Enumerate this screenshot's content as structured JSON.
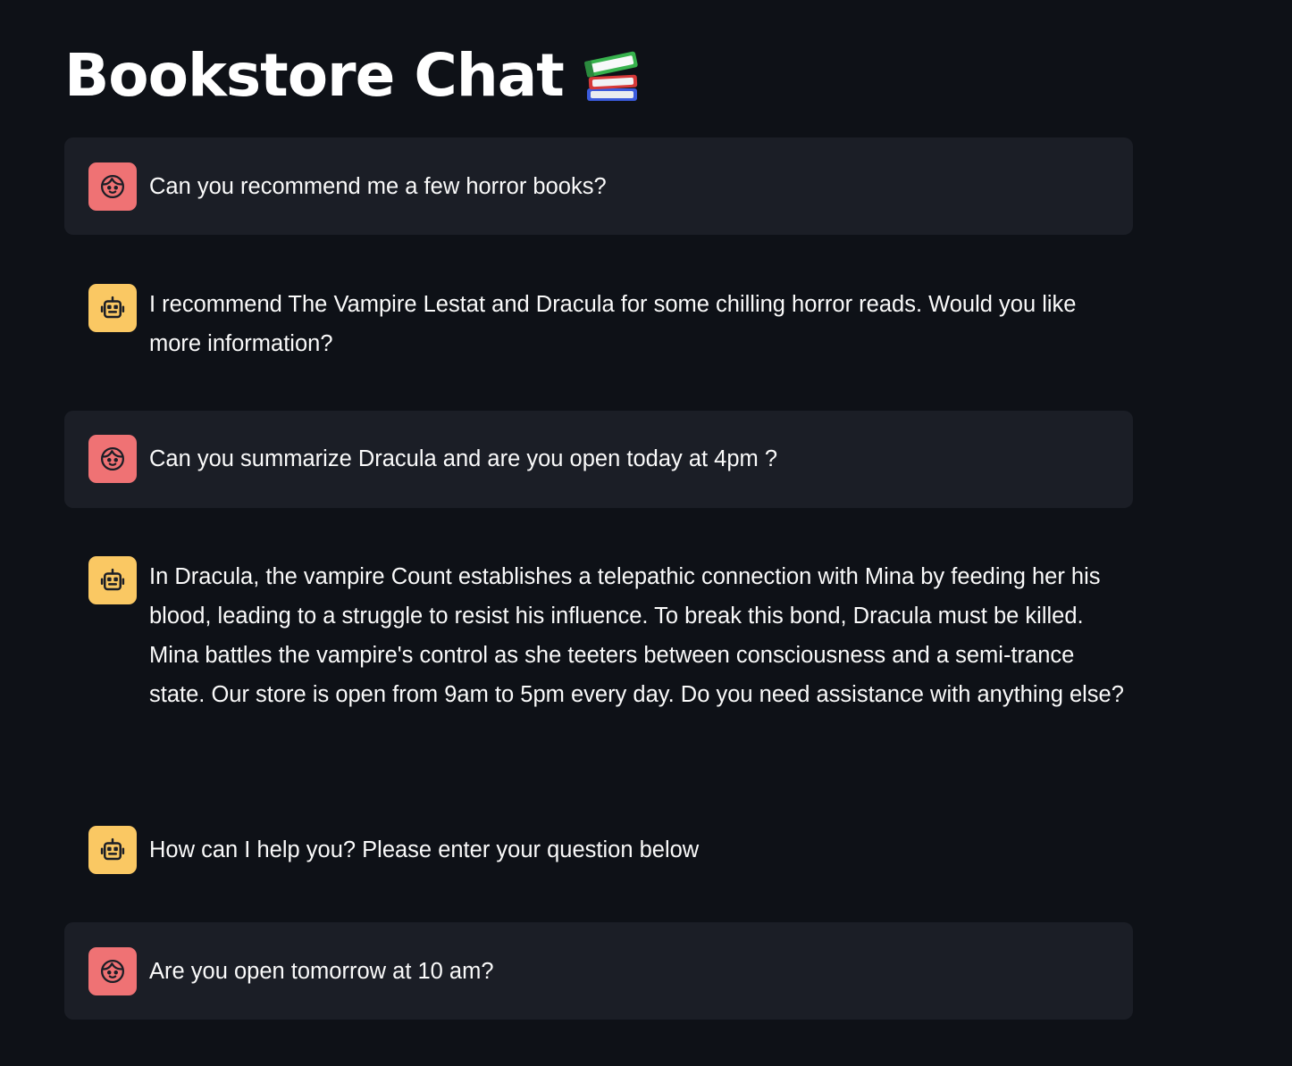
{
  "header": {
    "title": "Bookstore Chat",
    "title_icon": "books-icon"
  },
  "colors": {
    "background": "#0e1117",
    "user_bubble": "#1b1e26",
    "user_avatar": "#ef7274",
    "assistant_avatar": "#fac863",
    "text": "#fafafa"
  },
  "messages": [
    {
      "role": "user",
      "avatar_icon": "user-face-icon",
      "text": "Can you recommend me a few horror books?"
    },
    {
      "role": "assistant",
      "avatar_icon": "robot-icon",
      "text": "I recommend The Vampire Lestat and Dracula for some chilling horror reads. Would you like more information?"
    },
    {
      "role": "user",
      "avatar_icon": "user-face-icon",
      "text": "Can you summarize Dracula and are you open today at 4pm ?"
    },
    {
      "role": "assistant",
      "avatar_icon": "robot-icon",
      "text": "In Dracula, the vampire Count establishes a telepathic connection with Mina by feeding her his blood, leading to a struggle to resist his influence. To break this bond, Dracula must be killed. Mina battles the vampire's control as she teeters between consciousness and a semi-trance state. Our store is open from 9am to 5pm every day. Do you need assistance with anything else?"
    },
    {
      "role": "assistant",
      "avatar_icon": "robot-icon",
      "text": "How can I help you? Please enter your question below"
    },
    {
      "role": "user",
      "avatar_icon": "user-face-icon",
      "text": "Are you open tomorrow at 10 am?"
    }
  ]
}
